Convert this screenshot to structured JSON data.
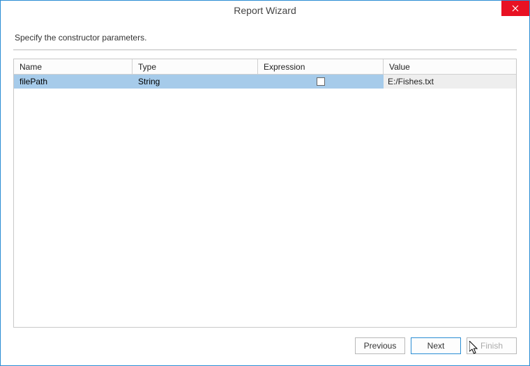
{
  "title": "Report Wizard",
  "instruction": "Specify the constructor parameters.",
  "table": {
    "headers": {
      "name": "Name",
      "type": "Type",
      "expression": "Expression",
      "value": "Value"
    },
    "rows": [
      {
        "name": "filePath",
        "type": "String",
        "expression_checked": false,
        "value": "E:/Fishes.txt"
      }
    ]
  },
  "buttons": {
    "previous": "Previous",
    "next": "Next",
    "finish": "Finish"
  }
}
